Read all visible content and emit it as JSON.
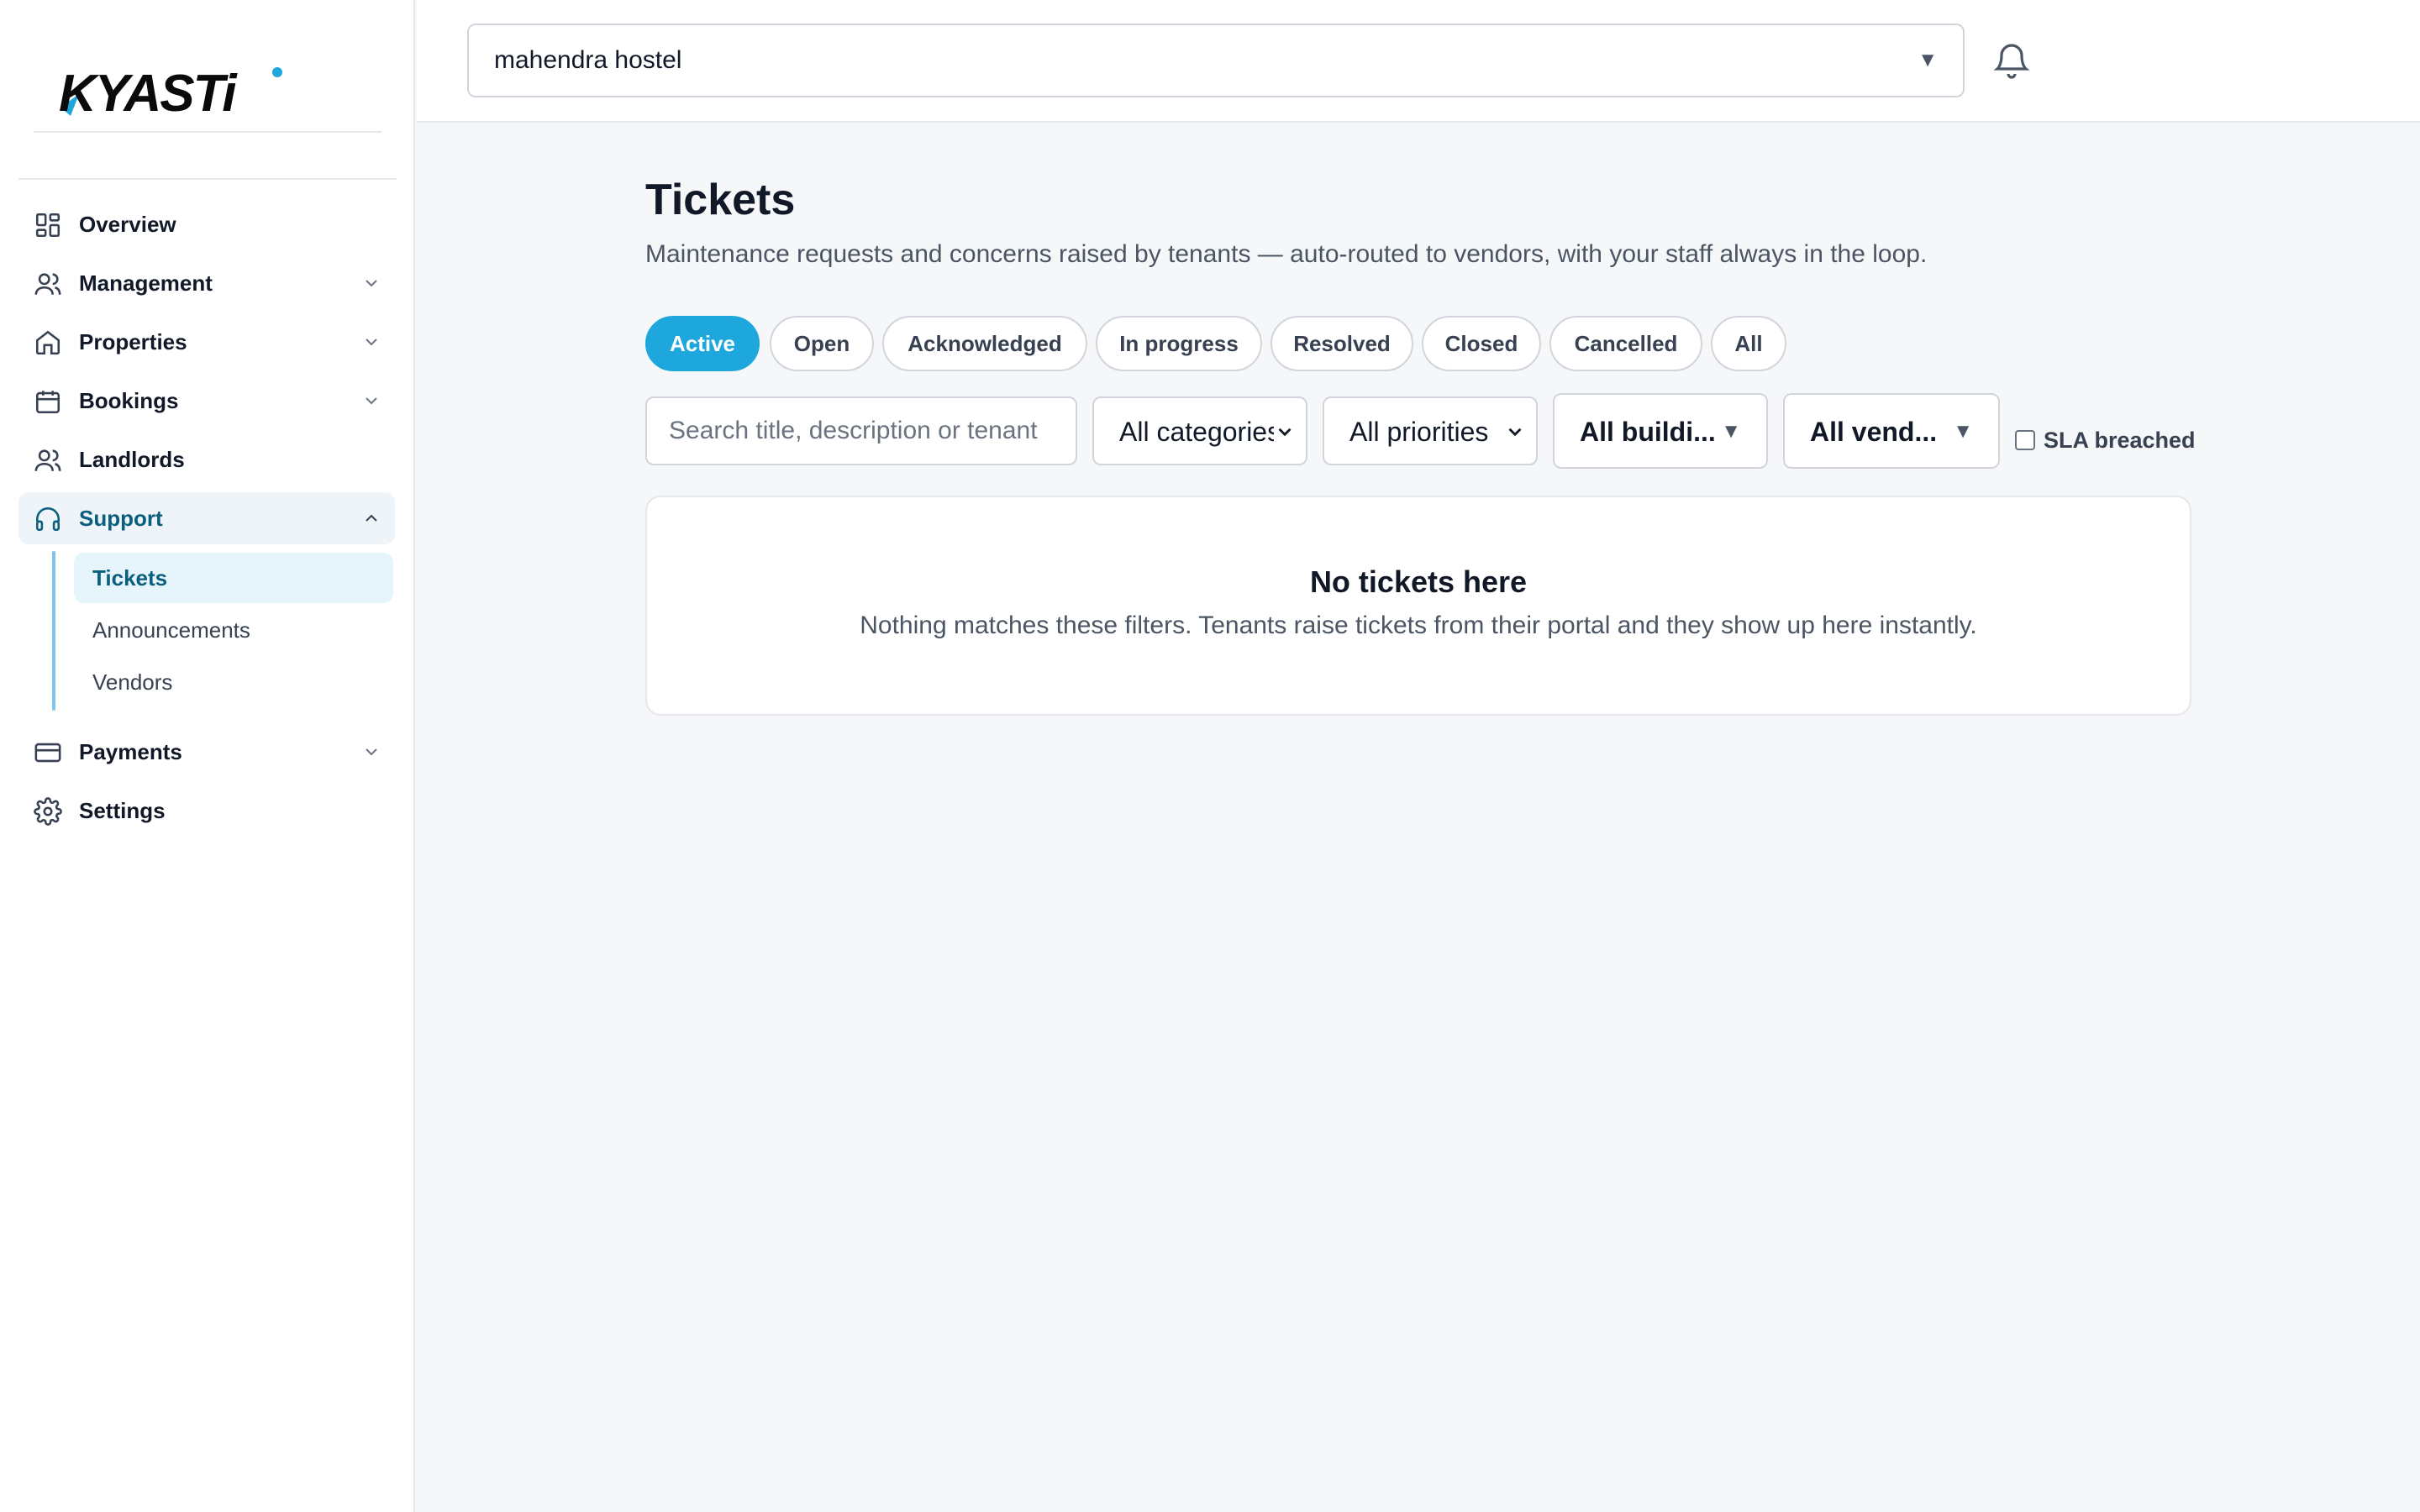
{
  "brand": {
    "name": "KYASTi",
    "accent": "#1ea7dc",
    "primary_text": "#0b5f7e"
  },
  "sidebar": {
    "items": [
      {
        "label": "Overview",
        "icon": "dashboard-grid-icon",
        "expandable": false
      },
      {
        "label": "Management",
        "icon": "users-icon",
        "expandable": true
      },
      {
        "label": "Properties",
        "icon": "home-icon",
        "expandable": true
      },
      {
        "label": "Bookings",
        "icon": "calendar-icon",
        "expandable": true
      },
      {
        "label": "Landlords",
        "icon": "users-icon",
        "expandable": false
      },
      {
        "label": "Support",
        "icon": "headphones-icon",
        "expandable": true,
        "expanded": true,
        "active": true
      },
      {
        "label": "Payments",
        "icon": "credit-card-icon",
        "expandable": true
      },
      {
        "label": "Settings",
        "icon": "gear-icon",
        "expandable": false
      }
    ],
    "support_sub": [
      {
        "label": "Tickets",
        "active": true
      },
      {
        "label": "Announcements"
      },
      {
        "label": "Vendors"
      }
    ]
  },
  "topbar": {
    "property_selected": "mahendra hostel",
    "dropdown_glyph": "▼",
    "notifications_icon": "bell-icon"
  },
  "page": {
    "title": "Tickets",
    "subtitle": "Maintenance requests and concerns raised by tenants — auto-routed to vendors, with your staff always in the loop."
  },
  "tabs": [
    {
      "label": "Active",
      "active": true
    },
    {
      "label": "Open"
    },
    {
      "label": "Acknowledged"
    },
    {
      "label": "In progress"
    },
    {
      "label": "Resolved"
    },
    {
      "label": "Closed"
    },
    {
      "label": "Cancelled"
    },
    {
      "label": "All"
    }
  ],
  "filters": {
    "search_placeholder": "Search title, description or tenant",
    "category": "All categories",
    "priority": "All priorities",
    "building": "All buildi...",
    "vendor": "All vend...",
    "sla_label": "SLA breached",
    "sla_checked": false
  },
  "empty_state": {
    "title": "No tickets here",
    "description": "Nothing matches these filters. Tenants raise tickets from their portal and they show up here instantly."
  }
}
